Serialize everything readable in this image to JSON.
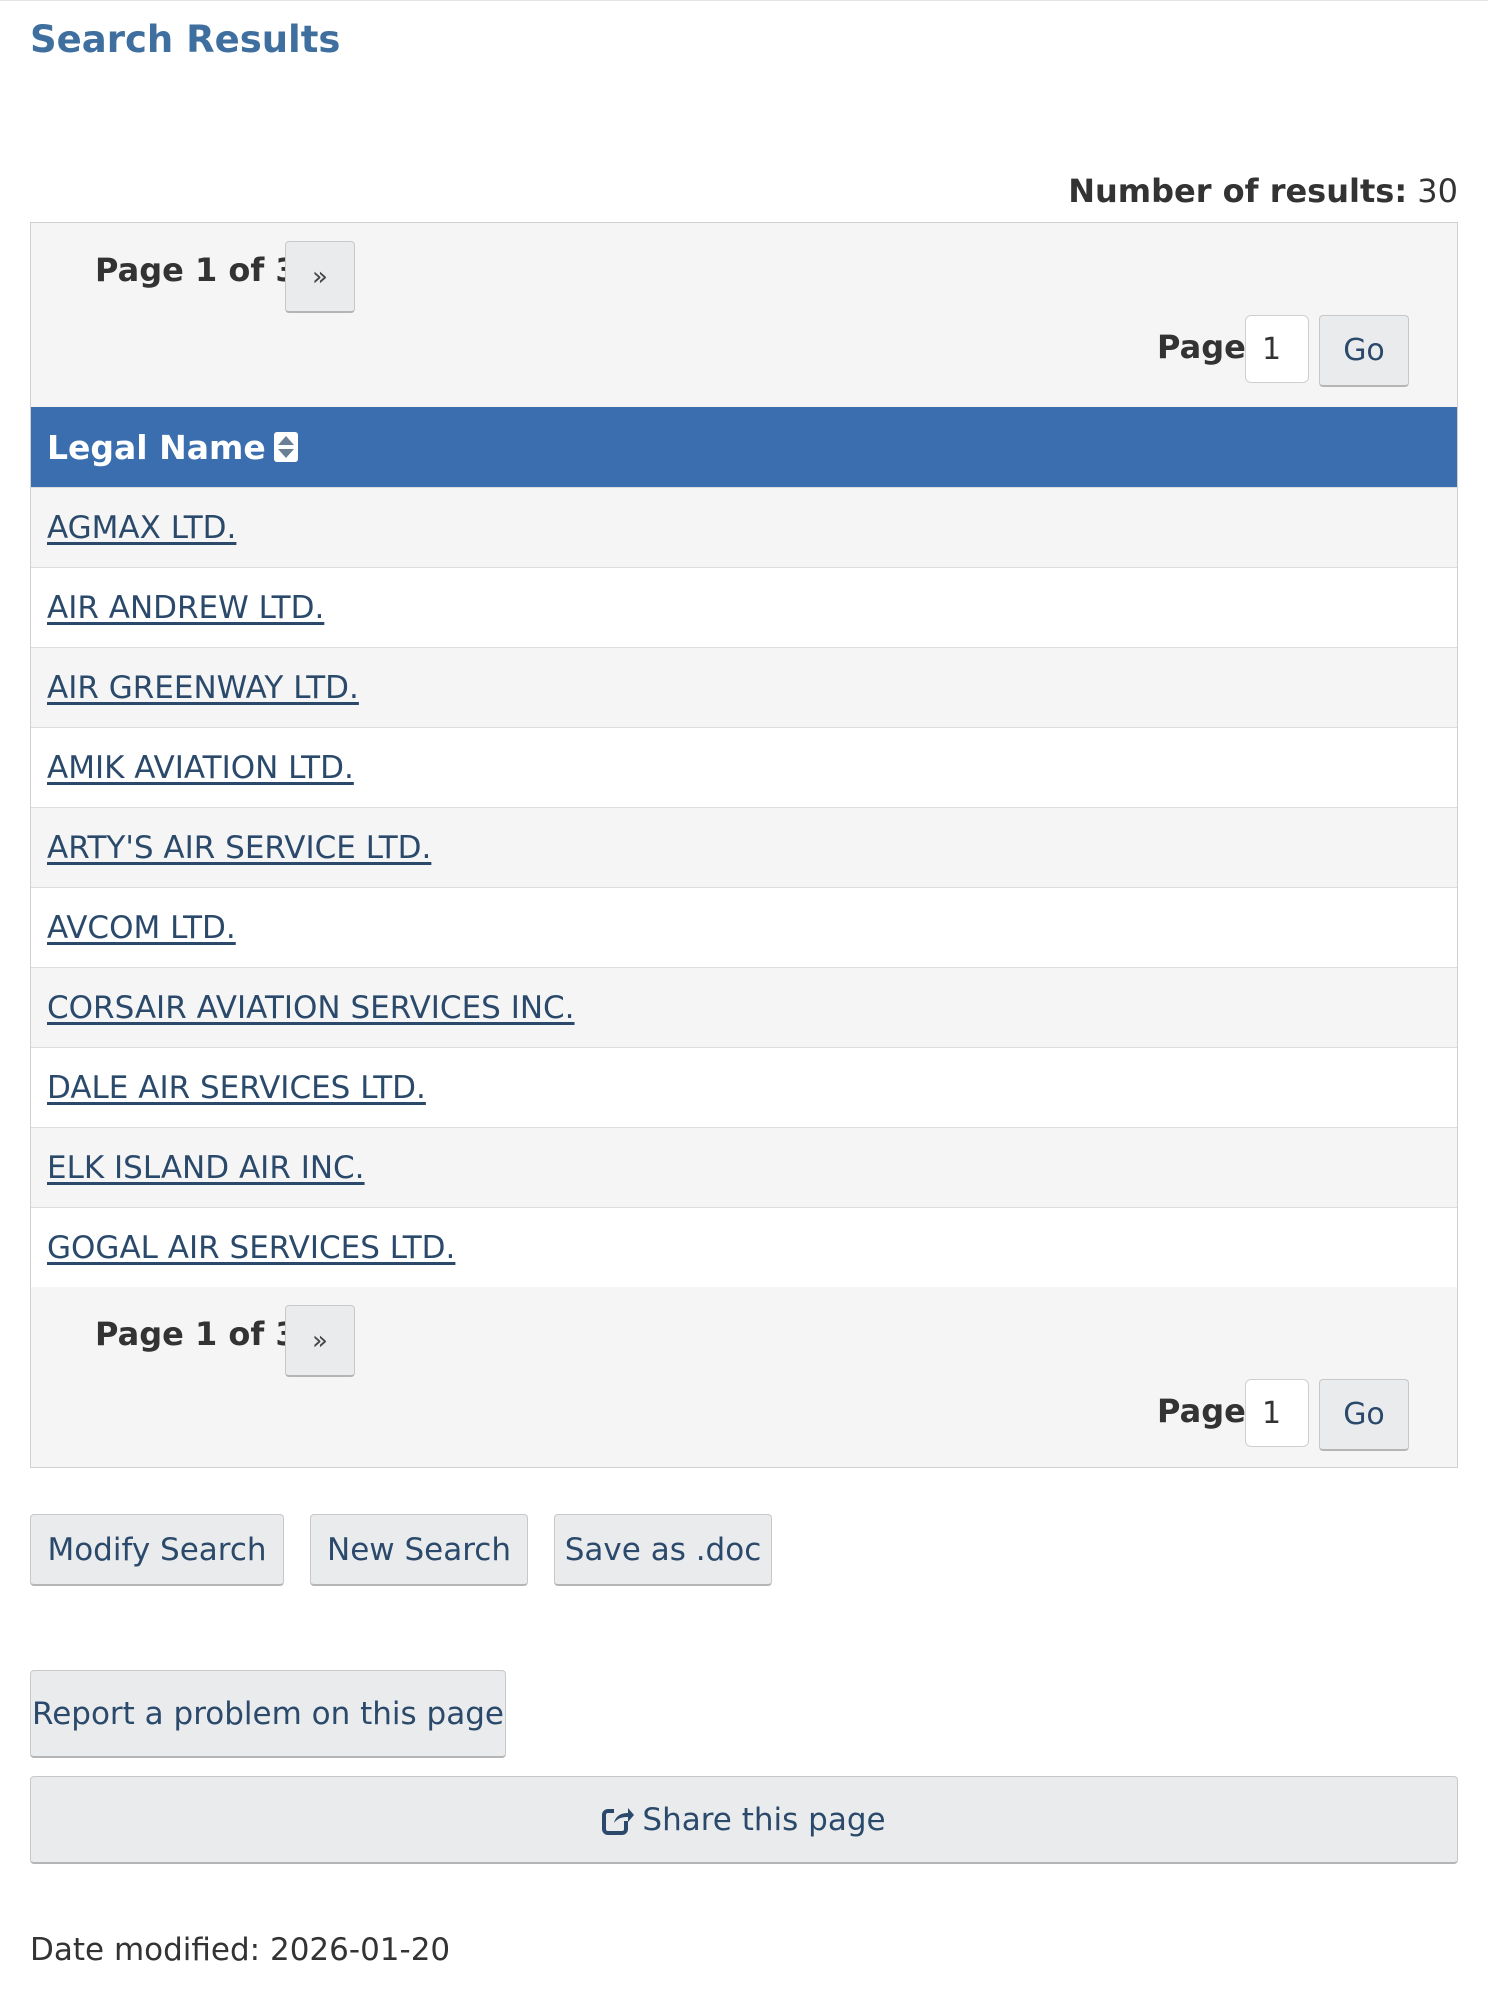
{
  "page": {
    "title": "Search Results",
    "result_count_label": "Number of results:",
    "result_count_value": "30"
  },
  "pager": {
    "label": "Page 1 of 3",
    "next_label": "»",
    "jump_label": "Page",
    "jump_value": "1",
    "go_label": "Go"
  },
  "table": {
    "column_header": "Legal Name",
    "rows": [
      "AGMAX LTD.",
      "AIR ANDREW LTD.",
      "AIR GREENWAY LTD.",
      "AMIK AVIATION LTD.",
      "ARTY'S AIR SERVICE LTD.",
      "AVCOM LTD.",
      "CORSAIR AVIATION SERVICES INC.",
      "DALE AIR SERVICES LTD.",
      "ELK ISLAND AIR INC.",
      "GOGAL AIR SERVICES LTD."
    ]
  },
  "actions": {
    "modify_search": "Modify Search",
    "new_search": "New Search",
    "save_doc": "Save as .doc"
  },
  "footer": {
    "report_problem": "Report a problem on this page",
    "share_page": "Share this page",
    "share_icon": "share-icon",
    "date_label": "Date modified:",
    "date_value": "2026-01-20"
  },
  "colors": {
    "title": "#3e6f9e",
    "header_bg": "#3b6eaf",
    "link": "#2b4a6b"
  }
}
